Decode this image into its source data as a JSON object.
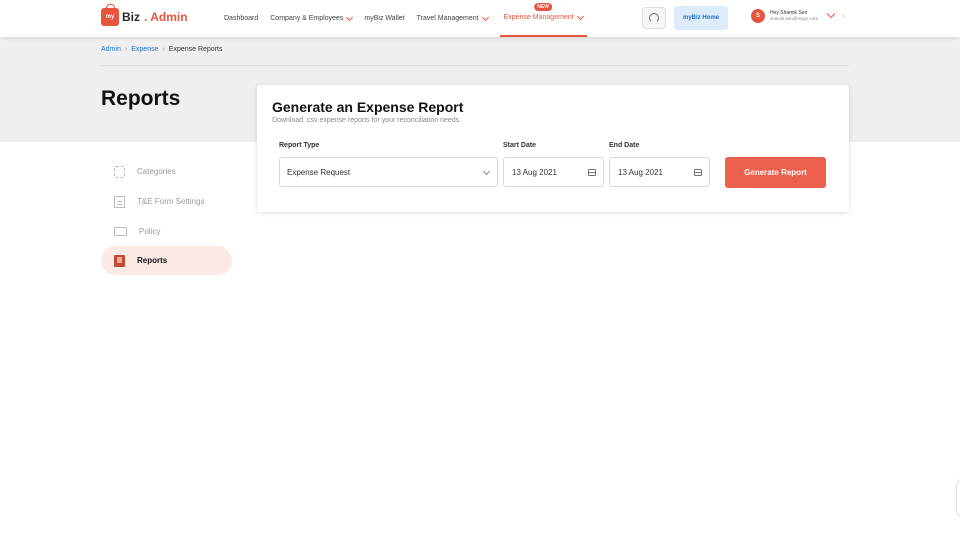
{
  "header": {
    "logo_bag": "my",
    "logo_text": "Biz",
    "logo_admin": ". Admin",
    "nav": [
      {
        "label": "Dashboard",
        "chevron": false
      },
      {
        "label": "Company & Employees",
        "chevron": true
      },
      {
        "label": "myBiz Wallet",
        "chevron": false
      },
      {
        "label": "Travel Management",
        "chevron": true
      },
      {
        "label": "Expense Management",
        "chevron": true,
        "badge": "NEW",
        "active": true
      }
    ],
    "home_button": "myBiz Home",
    "user": {
      "initial": "S",
      "name": "Hey Shamik Sen",
      "email": "shamik.sen@mygo.com"
    }
  },
  "breadcrumb": [
    "Admin",
    "Expense",
    "Expense Reports"
  ],
  "page_title": "Reports",
  "sidebar": [
    {
      "label": "Categories",
      "icon": "categories-icon"
    },
    {
      "label": "T&E Form Settings",
      "icon": "form-settings-icon"
    },
    {
      "label": "Policy",
      "icon": "policy-icon"
    },
    {
      "label": "Reports",
      "icon": "reports-icon",
      "active": true
    }
  ],
  "card": {
    "title": "Generate an Expense Report",
    "subtitle": "Download .csv expense reports for your reconciliation needs.",
    "report_type_label": "Report Type",
    "report_type_value": "Expense Request",
    "start_date_label": "Start Date",
    "start_date_value": "13 Aug 2021",
    "end_date_label": "End Date",
    "end_date_value": "13 Aug 2021",
    "generate_button": "Generate Report"
  },
  "colors": {
    "accent": "#e8553e",
    "link": "#1f6fd0",
    "band": "#efefef"
  }
}
